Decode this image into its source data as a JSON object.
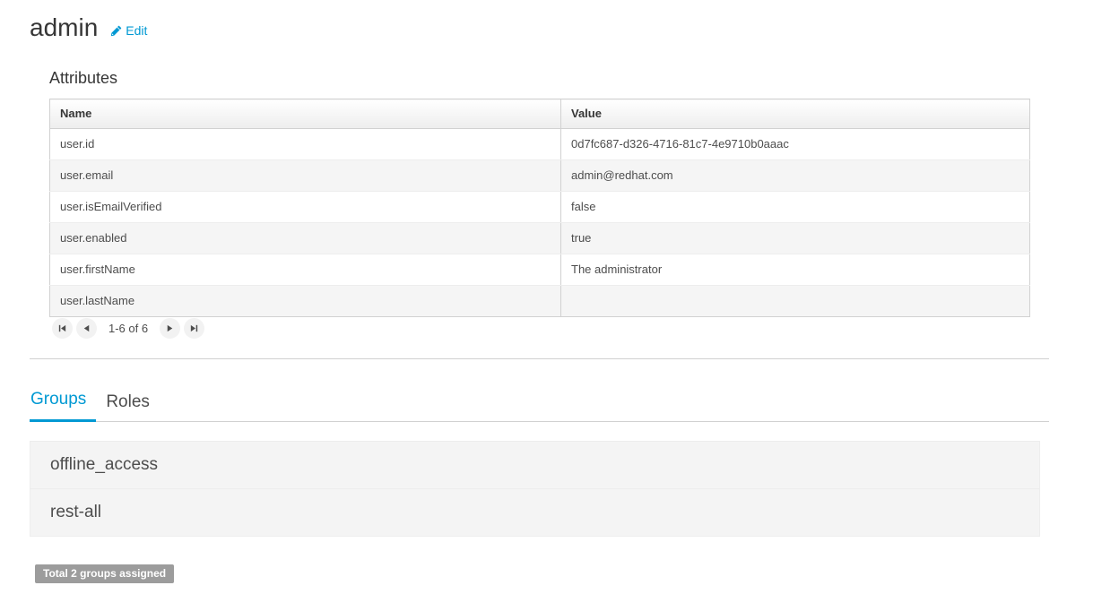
{
  "header": {
    "title": "admin",
    "edit_label": "Edit",
    "edit_icon": "pencil-icon",
    "accent_color": "#0099d3"
  },
  "attributes": {
    "heading": "Attributes",
    "columns": [
      "Name",
      "Value"
    ],
    "rows": [
      {
        "name": "user.id",
        "value": "0d7fc687-d326-4716-81c7-4e9710b0aaac"
      },
      {
        "name": "user.email",
        "value": "admin@redhat.com"
      },
      {
        "name": "user.isEmailVerified",
        "value": "false"
      },
      {
        "name": "user.enabled",
        "value": "true"
      },
      {
        "name": "user.firstName",
        "value": "The administrator"
      },
      {
        "name": "user.lastName",
        "value": ""
      }
    ],
    "pagination": {
      "first_icon": "first-page-icon",
      "prev_icon": "previous-page-icon",
      "next_icon": "next-page-icon",
      "last_icon": "last-page-icon",
      "range_label": "1-6 of 6"
    }
  },
  "tabs": [
    {
      "label": "Groups",
      "active": true
    },
    {
      "label": "Roles",
      "active": false
    }
  ],
  "groups": {
    "items": [
      {
        "name": "offline_access"
      },
      {
        "name": "rest-all"
      }
    ],
    "total_label": "Total 2 groups assigned",
    "badge_color": "#9c9c9c"
  }
}
